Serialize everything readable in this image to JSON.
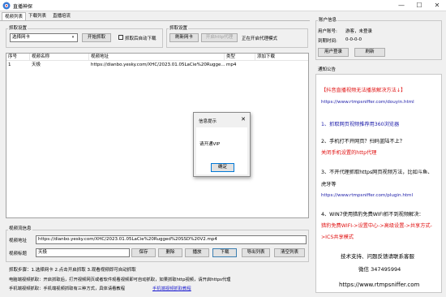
{
  "window": {
    "title": "直播神探",
    "minimize": "—",
    "maximize": "☐",
    "close": "✕"
  },
  "tabs": [
    "视频列表",
    "下载列表",
    "直播培流"
  ],
  "capture": {
    "group_title": "抓取设置",
    "combo_value": "选择网卡",
    "combo_arrow": "▾",
    "start_button": "开始抓取",
    "auto_label": "抓取后自动下载"
  },
  "capture_settings": {
    "group_title": "抓取设置",
    "refresh_nic_button": "刷新网卡",
    "http_proxy_button": "开启http代理",
    "status_text": "正在开启代理模式"
  },
  "table": {
    "columns": [
      "序号",
      "视频名称",
      "视频地址",
      "类型",
      "添加下载"
    ],
    "rows": [
      {
        "index": "1",
        "name": "天极",
        "url": "https://dianbo.yesky.com/XHC/2023.01.05LaCie%20Rugge...",
        "type": "mp4",
        "add": ""
      }
    ]
  },
  "video_info": {
    "group_title": "视频流信息",
    "address_label": "视频地址",
    "address_value": "https://dianbo.yesky.com/XHC/2023.01.05LaCie%20Rugged%20SSD%20V2.mp4",
    "title_label": "视频标题",
    "title_value": "天极",
    "buttons": {
      "save": "保存",
      "delete": "删除",
      "play": "播放",
      "download": "下载",
      "export": "导出列表",
      "clear": "清空列表"
    }
  },
  "help": {
    "steps": "抓取步骤：1.选择网卡  2.点击开启抓取  3.观看视频即可自动抓取",
    "pc_tip": "电脑端视频抓取：开启抓取后，打开视频网页或者软件观看视频即可自动抓取，如果抓取http视频，请开启https代理",
    "mobile_tip_prefix": "手机端视频抓取：手机端视频抓取有三种方式，具体请看教程",
    "mobile_tip_link": "手机端视频抓取教程"
  },
  "account": {
    "group_title": "账户信息",
    "user_label": "用户账号:",
    "user_value": "游客，未登录",
    "expire_label": "到期时间:",
    "expire_value": "0-0-0-0",
    "login_button": "用户登录",
    "refresh_button": "刷新"
  },
  "announcement": {
    "group_title": "通知公告",
    "headline": "【抖音直播视频无法播放解决方法↓】",
    "url1": "https://www.rtmpsniffer.com/douyin.html",
    "item1": "1、抓取网页视频推荐用360浏览器",
    "item2": "2、手机打不开网页？扫码蓝陆不上？",
    "item2_link": "关闭手机设置的http代理",
    "item3_line1": "3、不开代理抓取https网页视频方法，比如斗鱼、",
    "item3_line2": "虎牙等",
    "url3": "https://www.rtmpsniffer.com/plugin.html",
    "item4": "4、WIN7使用猎豹免费WIFI抓不到视频解决：",
    "item4_link_line1": "猎豹免费WIFI->设置中心->高级设置->共享方式-",
    "item4_link_line2": ">ICS共享模式",
    "support_line1": "技术支持、问题反馈请联系客服",
    "support_line2": "微信 347495994",
    "footer_url": "https://www.rtmpsniffer.com"
  },
  "dialog": {
    "title": "信息提示",
    "close": "✕",
    "message": "请开通VIP",
    "ok": "确定"
  },
  "colors": {
    "accent_red": "#e01010",
    "link_blue": "#1a1ad0",
    "text_blue": "#1a1aa8"
  }
}
